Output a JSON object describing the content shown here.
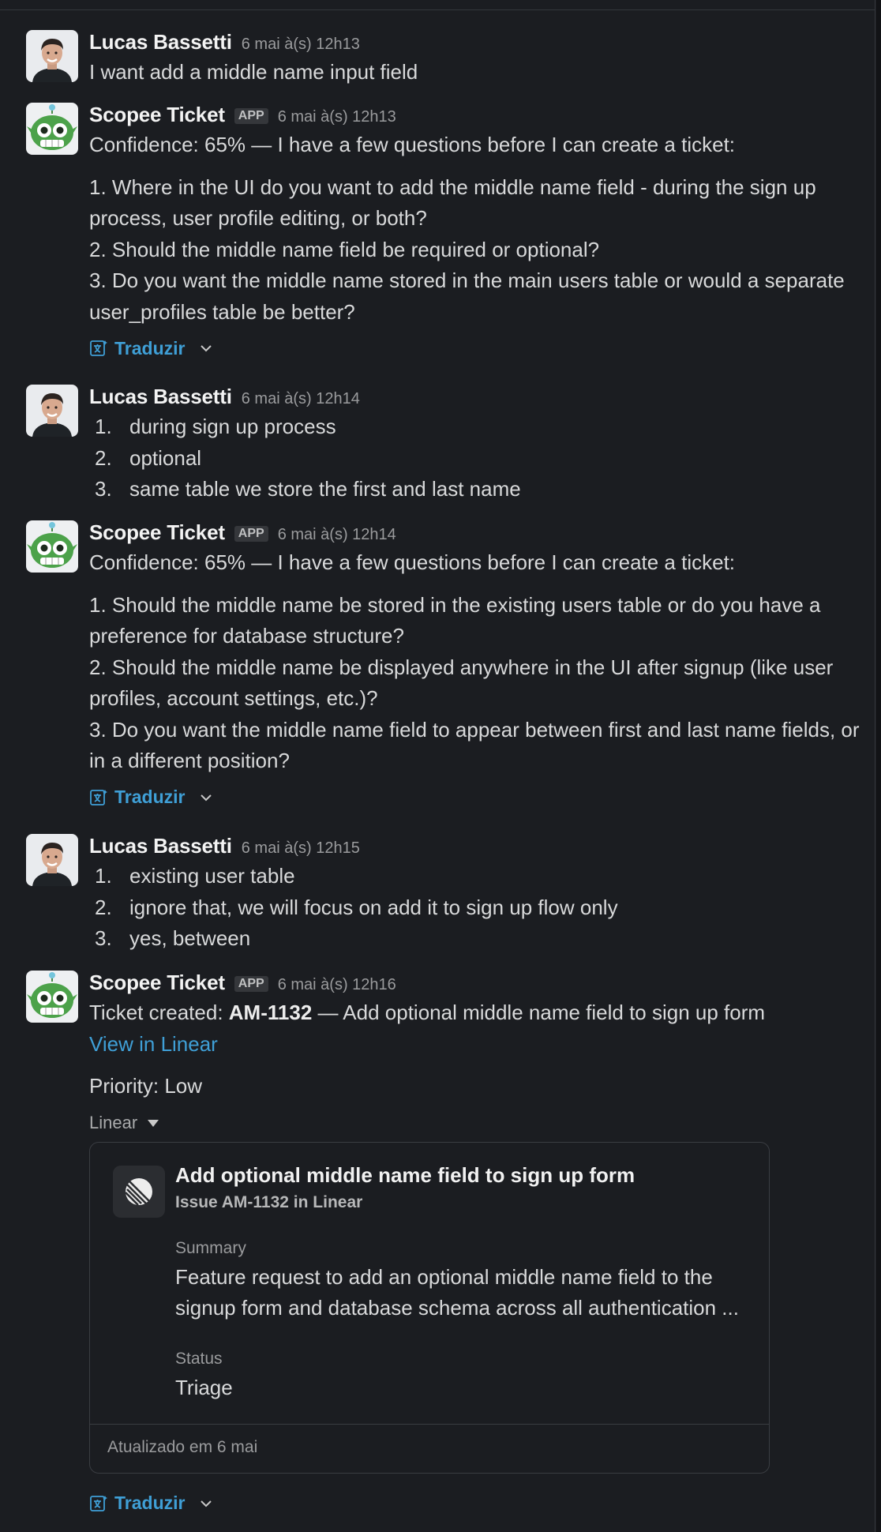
{
  "messages": [
    {
      "sender": "Lucas Bassetti",
      "time": "6 mai à(s) 12h13",
      "text": "I want add a middle name input field"
    },
    {
      "sender": "Scopee Ticket",
      "badge": "APP",
      "time": "6 mai à(s) 12h13",
      "intro": "Confidence: 65% — I have a few questions before I can create a ticket:",
      "questions": [
        "1. Where in the UI do you want to add the middle name field - during the sign up process, user profile editing, or both?",
        "2. Should the middle name field be required or optional?",
        "3. Do you want the middle name stored in the main users table or would a separate user_profiles table be better?"
      ],
      "translate": "Traduzir"
    },
    {
      "sender": "Lucas Bassetti",
      "time": "6 mai à(s) 12h14",
      "items": [
        {
          "n": "1.",
          "t": "during sign up process"
        },
        {
          "n": "2.",
          "t": "optional"
        },
        {
          "n": "3.",
          "t": "same table we store the first and last name"
        }
      ]
    },
    {
      "sender": "Scopee Ticket",
      "badge": "APP",
      "time": "6 mai à(s) 12h14",
      "intro": "Confidence: 65% — I have a few questions before I can create a ticket:",
      "questions": [
        "1. Should the middle name be stored in the existing users table or do you have a preference for database structure?",
        "2. Should the middle name be displayed anywhere in the UI after signup (like user profiles, account settings, etc.)?",
        "3. Do you want the middle name field to appear between first and last name fields, or in a different position?"
      ],
      "translate": "Traduzir"
    },
    {
      "sender": "Lucas Bassetti",
      "time": "6 mai à(s) 12h15",
      "items": [
        {
          "n": "1.",
          "t": "existing user table"
        },
        {
          "n": "2.",
          "t": "ignore that, we will focus on add it to sign up flow only"
        },
        {
          "n": "3.",
          "t": "yes, between"
        }
      ]
    },
    {
      "sender": "Scopee Ticket",
      "badge": "APP",
      "time": "6 mai à(s) 12h16",
      "ticket_prefix": "Ticket created: ",
      "ticket_id": "AM-1132",
      "ticket_suffix": " — Add optional middle name field to sign up form",
      "view_link": "View in Linear",
      "priority": "Priority: Low",
      "unfurl_label": "Linear",
      "card": {
        "title": "Add optional middle name field to sign up form",
        "subtitle": "Issue AM-1132 in Linear",
        "summary_label": "Summary",
        "summary": "Feature request to add an optional middle name field to the signup form and database schema across all authentication ...",
        "status_label": "Status",
        "status": "Triage",
        "updated": "Atualizado em 6 mai"
      },
      "translate": "Traduzir"
    }
  ],
  "colors": {
    "background": "#1b1d21",
    "link": "#3f9fd6",
    "name": "#f3f3f3",
    "muted": "#9a9b9d"
  }
}
